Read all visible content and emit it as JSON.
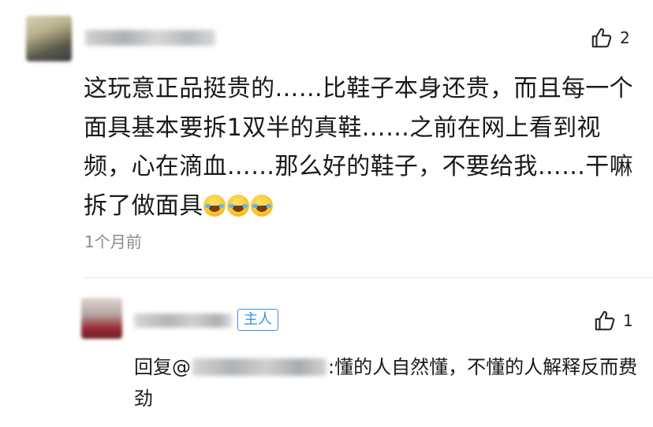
{
  "comment": {
    "like_count": "2",
    "text": "这玩意正品挺贵的……比鞋子本身还贵，而且每一个面具基本要拆1双半的真鞋……之前在网上看到视频，心在滴血……那么好的鞋子，不要给我……干嘛拆了做面具",
    "emoji": "laugh-cry-emoji",
    "time": "1个月前"
  },
  "reply": {
    "badge": "主人",
    "like_count": "1",
    "prefix": "回复@",
    "text": ":懂的人自然懂，不懂的人解释反而费劲"
  },
  "icons": {
    "like": "thumbs-up-icon"
  },
  "colors": {
    "badge": "#3f8ee8",
    "time": "#8a8a8a"
  }
}
